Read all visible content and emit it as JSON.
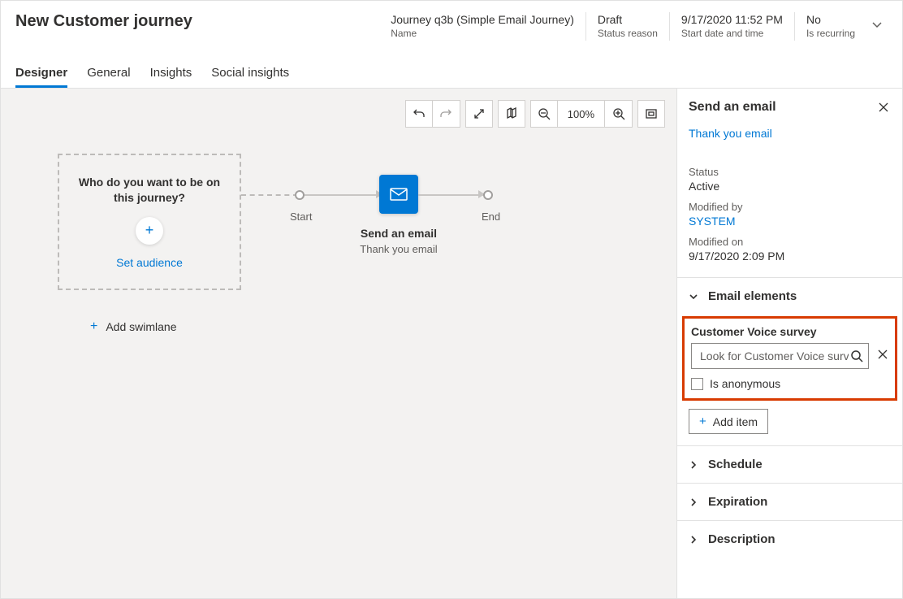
{
  "header": {
    "title": "New Customer journey",
    "meta": [
      {
        "value": "Journey q3b (Simple Email Journey)",
        "label": "Name"
      },
      {
        "value": "Draft",
        "label": "Status reason"
      },
      {
        "value": "9/17/2020 11:52 PM",
        "label": "Start date and time"
      },
      {
        "value": "No",
        "label": "Is recurring"
      }
    ]
  },
  "tabs": [
    "Designer",
    "General",
    "Insights",
    "Social insights"
  ],
  "toolbar": {
    "zoom": "100%"
  },
  "audience": {
    "question": "Who do you want to be on this journey?",
    "set_link": "Set audience"
  },
  "flow": {
    "start": "Start",
    "end": "End",
    "node_title": "Send an email",
    "node_sub": "Thank you email"
  },
  "add_swimlane": "Add swimlane",
  "panel": {
    "title": "Send an email",
    "subtitle": "Thank you email",
    "status_lbl": "Status",
    "status_val": "Active",
    "mod_by_lbl": "Modified by",
    "mod_by_val": "SYSTEM",
    "mod_on_lbl": "Modified on",
    "mod_on_val": "9/17/2020 2:09 PM",
    "email_elements": "Email elements",
    "cv_label": "Customer Voice survey",
    "cv_placeholder": "Look for Customer Voice survey",
    "is_anon": "Is anonymous",
    "add_item": "Add item",
    "schedule": "Schedule",
    "expiration": "Expiration",
    "description": "Description"
  }
}
